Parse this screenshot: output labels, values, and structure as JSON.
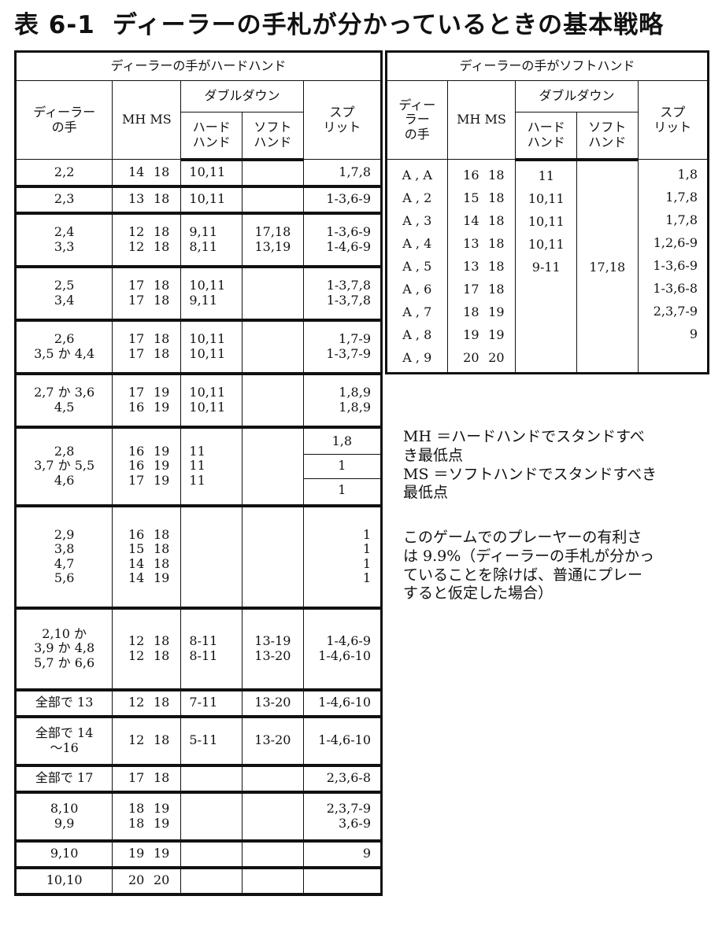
{
  "title": {
    "num": "表 6-1",
    "text": "ディーラーの手札が分かっているときの基本戦略"
  },
  "left": {
    "group_header": "ディーラーの手がハードハンド",
    "headers": {
      "dealer": "ディーラー\nの手",
      "mhms": "MH MS",
      "double": "ダブルダウン",
      "hard": "ハード\nハンド",
      "soft": "ソフト\nハンド",
      "split": "スプ\nリット"
    },
    "rows": [
      {
        "hands": [
          "2,2"
        ],
        "mh": [
          "14"
        ],
        "ms": [
          "18"
        ],
        "hard": [
          "10,11"
        ],
        "soft": [
          ""
        ],
        "split": [
          "1,7,8"
        ]
      },
      {
        "hands": [
          "2,3"
        ],
        "mh": [
          "13"
        ],
        "ms": [
          "18"
        ],
        "hard": [
          "10,11"
        ],
        "soft": [
          ""
        ],
        "split": [
          "1-3,6-9"
        ]
      },
      {
        "hands": [
          "2,4",
          "3,3"
        ],
        "mh": [
          "12",
          "12"
        ],
        "ms": [
          "18",
          "18"
        ],
        "hard": [
          "9,11",
          "8,11"
        ],
        "soft": [
          "17,18",
          "13,19"
        ],
        "split": [
          "1-3,6-9",
          "1-4,6-9"
        ]
      },
      {
        "hands": [
          "2,5",
          "3,4"
        ],
        "mh": [
          "17",
          "17"
        ],
        "ms": [
          "18",
          "18"
        ],
        "hard": [
          "10,11",
          "9,11"
        ],
        "soft": [
          "",
          ""
        ],
        "split": [
          "1-3,7,8",
          "1-3,7,8"
        ]
      },
      {
        "hands": [
          "2,6",
          "3,5 か 4,4"
        ],
        "mh": [
          "17",
          "17"
        ],
        "ms": [
          "18",
          "18"
        ],
        "hard": [
          "10,11",
          "10,11"
        ],
        "soft": [
          "",
          ""
        ],
        "split": [
          "1,7-9",
          "1-3,7-9"
        ]
      },
      {
        "hands": [
          "2,7 か 3,6",
          "4,5"
        ],
        "mh": [
          "17",
          "16"
        ],
        "ms": [
          "19",
          "19"
        ],
        "hard": [
          "10,11",
          "10,11"
        ],
        "soft": [
          "",
          ""
        ],
        "split": [
          "1,8,9",
          "1,8,9"
        ]
      },
      {
        "hands": [
          "2,8",
          "3,7 か 5,5",
          "4,6"
        ],
        "mh": [
          "16",
          "16",
          "17"
        ],
        "ms": [
          "19",
          "19",
          "19"
        ],
        "hard": [
          "11",
          "11",
          "11"
        ],
        "soft": [
          "",
          "",
          ""
        ],
        "split": [
          "1,8",
          "1",
          "1"
        ],
        "split_boxed": true
      },
      {
        "hands": [
          "2,9",
          "3,8",
          "4,7",
          "5,6"
        ],
        "mh": [
          "16",
          "15",
          "14",
          "14"
        ],
        "ms": [
          "18",
          "18",
          "18",
          "19"
        ],
        "hard": [
          "",
          "",
          "",
          ""
        ],
        "soft": [
          "",
          "",
          "",
          ""
        ],
        "split": [
          "1",
          "1",
          "1",
          "1"
        ]
      },
      {
        "hands": [
          "2,10 か",
          "3,9 か 4,8",
          "5,7 か 6,6"
        ],
        "mh": [
          "12",
          "12"
        ],
        "ms": [
          "18",
          "18"
        ],
        "hard": [
          "8-11",
          "8-11"
        ],
        "soft": [
          "13-19",
          "13-20"
        ],
        "split": [
          "1-4,6-9",
          "1-4,6-10"
        ]
      },
      {
        "hands": [
          "全部で 13"
        ],
        "mh": [
          "12"
        ],
        "ms": [
          "18"
        ],
        "hard": [
          "7-11"
        ],
        "soft": [
          "13-20"
        ],
        "split": [
          "1-4,6-10"
        ]
      },
      {
        "hands": [
          "全部で 14",
          "～16"
        ],
        "mh": [
          "12"
        ],
        "ms": [
          "18"
        ],
        "hard": [
          "5-11"
        ],
        "soft": [
          "13-20"
        ],
        "split": [
          "1-4,6-10"
        ]
      },
      {
        "hands": [
          "全部で 17"
        ],
        "mh": [
          "17"
        ],
        "ms": [
          "18"
        ],
        "hard": [
          ""
        ],
        "soft": [
          ""
        ],
        "split": [
          "2,3,6-8"
        ]
      },
      {
        "hands": [
          "8,10",
          "9,9"
        ],
        "mh": [
          "18",
          "18"
        ],
        "ms": [
          "19",
          "19"
        ],
        "hard": [
          "",
          ""
        ],
        "soft": [
          "",
          ""
        ],
        "split": [
          "2,3,7-9",
          "3,6-9"
        ]
      },
      {
        "hands": [
          "9,10"
        ],
        "mh": [
          "19"
        ],
        "ms": [
          "19"
        ],
        "hard": [
          ""
        ],
        "soft": [
          ""
        ],
        "split": [
          "9"
        ]
      },
      {
        "hands": [
          "10,10"
        ],
        "mh": [
          "20"
        ],
        "ms": [
          "20"
        ],
        "hard": [
          ""
        ],
        "soft": [
          ""
        ],
        "split": [
          ""
        ]
      }
    ]
  },
  "right": {
    "group_header": "ディーラーの手がソフトハンド",
    "headers": {
      "dealer": "ディー\nラー\nの手",
      "mhms": "MH MS",
      "double": "ダブルダウン",
      "hard": "ハード\nハンド",
      "soft": "ソフト\nハンド",
      "split": "スプ\nリット"
    },
    "hands": [
      "A , A",
      "A , 2",
      "A , 3",
      "A , 4",
      "A , 5",
      "A , 6",
      "A , 7",
      "A , 8",
      "A , 9"
    ],
    "mh": [
      "16",
      "15",
      "14",
      "13",
      "13",
      "17",
      "18",
      "19",
      "20"
    ],
    "ms": [
      "18",
      "18",
      "18",
      "18",
      "18",
      "18",
      "19",
      "19",
      "20"
    ],
    "hard": [
      "11",
      "10,11",
      "10,11",
      "10,11",
      "9-11",
      "",
      "",
      "",
      ""
    ],
    "soft": [
      "",
      "",
      "",
      "",
      "17,18",
      "",
      "",
      "",
      ""
    ],
    "split": [
      "1,8",
      "1,7,8",
      "1,7,8",
      "1,2,6-9",
      "1-3,6-9",
      "1-3,6-8",
      "2,3,7-9",
      "9",
      ""
    ]
  },
  "notes": {
    "legend": "MH ＝ハードハンドでスタンドすべ\nき最低点\nMS ＝ソフトハンドでスタンドすべき\n最低点",
    "advantage": "このゲームでのプレーヤーの有利さ\nは 9.9%（ディーラーの手札が分かっ\nていることを除けば、普通にプレー\nすると仮定した場合）"
  }
}
